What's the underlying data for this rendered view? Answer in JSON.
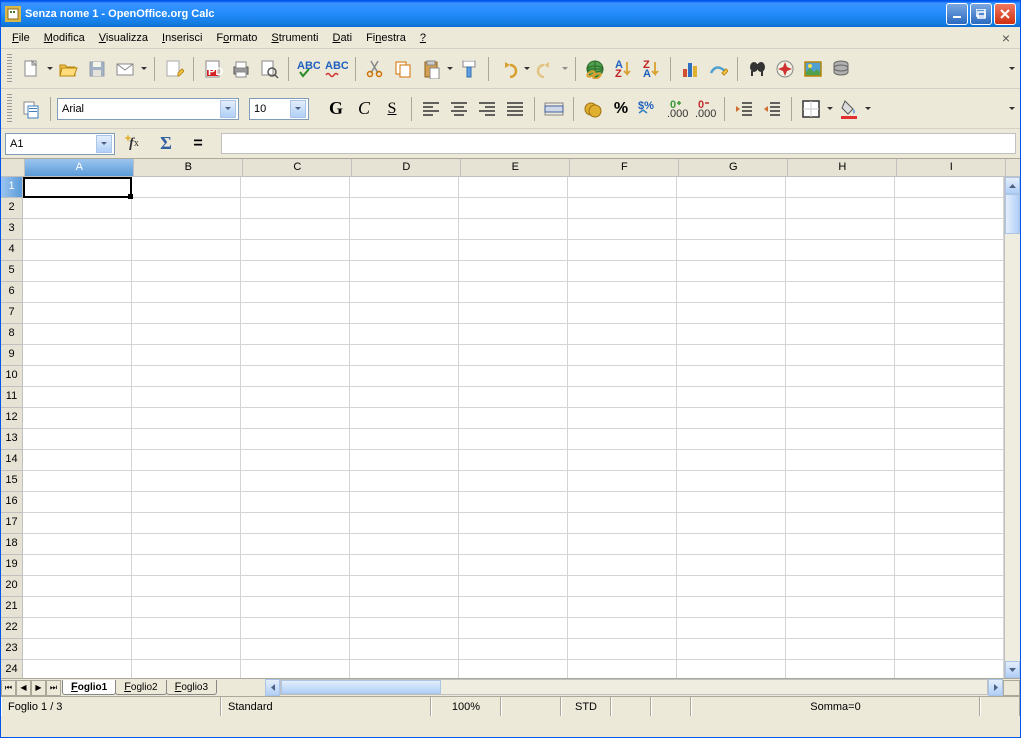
{
  "title": "Senza nome 1 - OpenOffice.org Calc",
  "menu": [
    "File",
    "Modifica",
    "Visualizza",
    "Inserisci",
    "Formato",
    "Strumenti",
    "Dati",
    "Finestra",
    "?"
  ],
  "menu_keys": [
    "F",
    "M",
    "V",
    "I",
    "o",
    "S",
    "D",
    "n",
    "?"
  ],
  "font": {
    "name": "Arial",
    "size": "10"
  },
  "namebox": "A1",
  "formula_eq": "=",
  "columns": [
    "A",
    "B",
    "C",
    "D",
    "E",
    "F",
    "G",
    "H",
    "I"
  ],
  "rows": [
    "1",
    "2",
    "3",
    "4",
    "5",
    "6",
    "7",
    "8",
    "9",
    "10",
    "11",
    "12",
    "13",
    "14",
    "15",
    "16",
    "17",
    "18",
    "19",
    "20",
    "21",
    "22",
    "23",
    "24"
  ],
  "selected_col": 0,
  "selected_row": 0,
  "sheets": [
    "Foglio1",
    "Foglio2",
    "Foglio3"
  ],
  "active_sheet": 0,
  "status": {
    "sheet": "Foglio 1 / 3",
    "style": "Standard",
    "zoom": "100%",
    "mode": "STD",
    "sum": "Somma=0"
  }
}
